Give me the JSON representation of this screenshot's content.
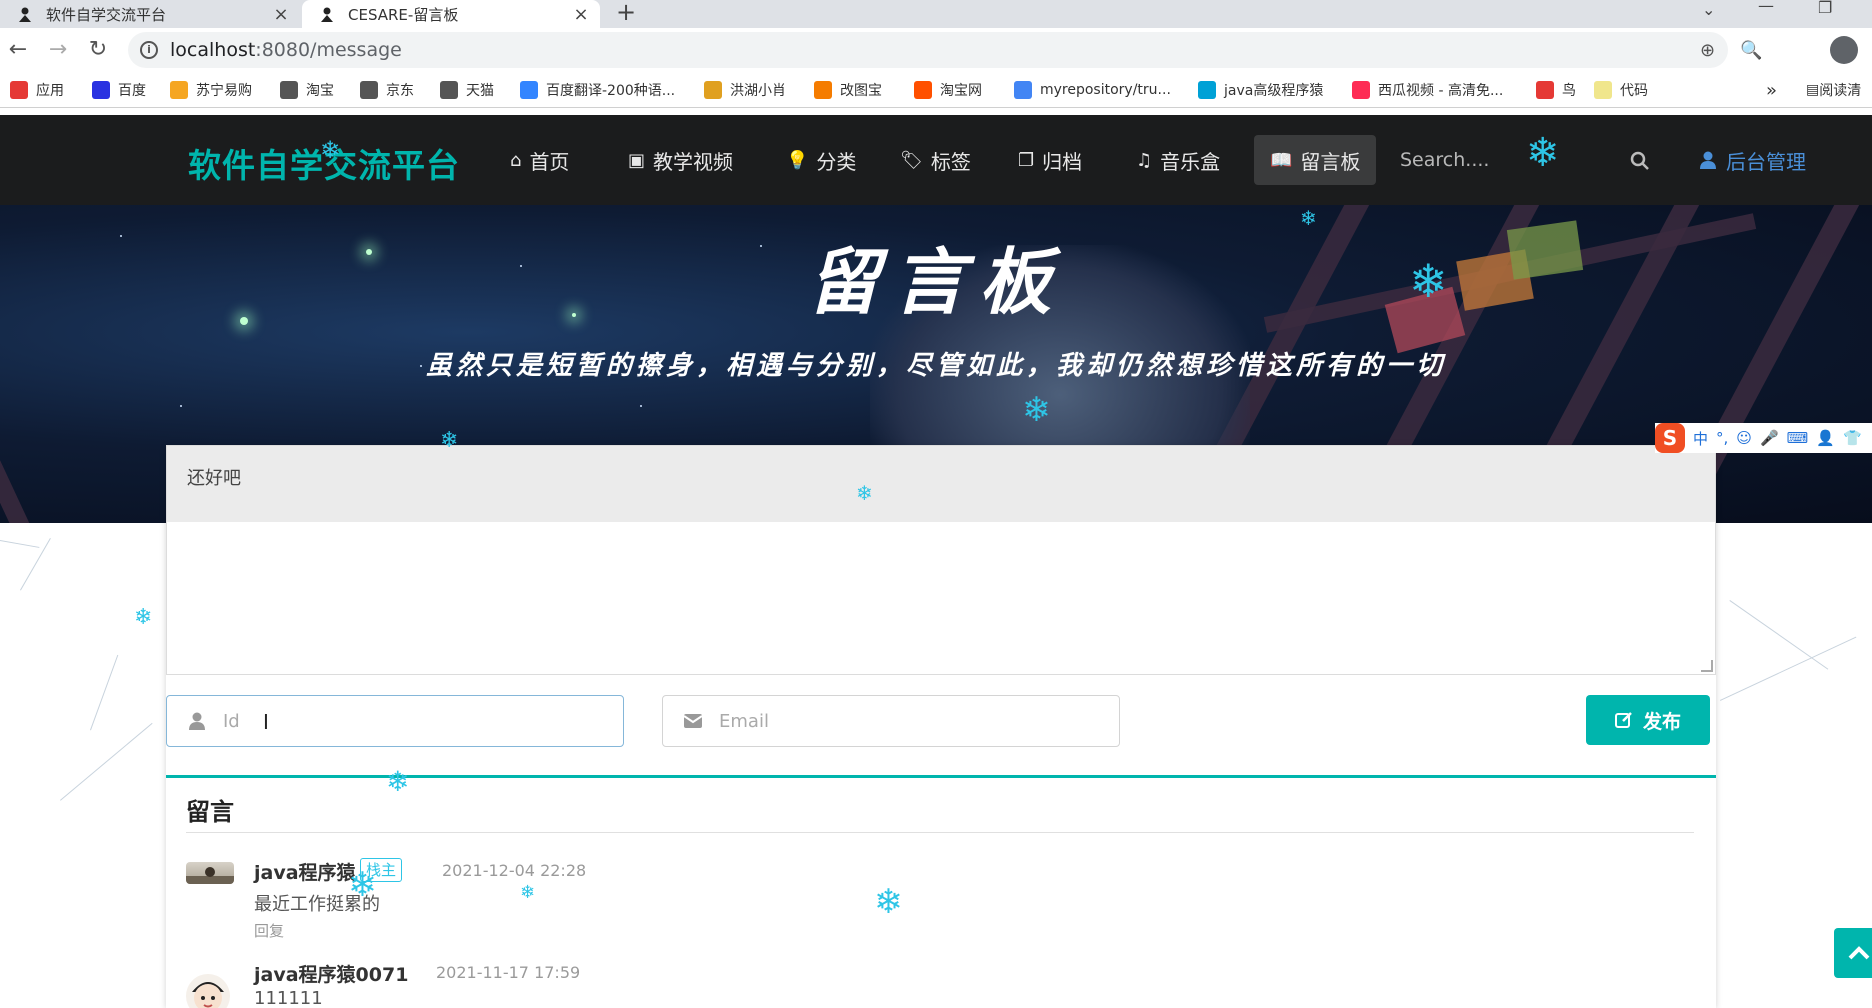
{
  "browser": {
    "tabs": [
      {
        "title": "软件自学交流平台",
        "close": "×"
      },
      {
        "title": "CESARE-留言板",
        "close": "×"
      }
    ],
    "new_tab": "+",
    "url_host": "localhost",
    "url_path": ":8080/message",
    "bookmarks": [
      {
        "label": "应用",
        "icon": "apps-grid-icon",
        "color": "#e53935"
      },
      {
        "label": "百度",
        "icon": "baidu-paw-icon",
        "color": "#2932e1"
      },
      {
        "label": "苏宁易购",
        "icon": "suning-icon",
        "color": "#f5a623"
      },
      {
        "label": "淘宝",
        "icon": "globe-icon",
        "color": "#555555"
      },
      {
        "label": "京东",
        "icon": "globe-icon",
        "color": "#555555"
      },
      {
        "label": "天猫",
        "icon": "globe-icon",
        "color": "#555555"
      },
      {
        "label": "百度翻译-200种语...",
        "icon": "translate-icon",
        "color": "#3385ff"
      },
      {
        "label": "洪湖小肖",
        "icon": "bird-icon",
        "color": "#e0a020"
      },
      {
        "label": "改图宝",
        "icon": "image-icon",
        "color": "#f57c00"
      },
      {
        "label": "淘宝网",
        "icon": "taobao-icon",
        "color": "#ff5000"
      },
      {
        "label": "myrepository/tru...",
        "icon": "chrome-icon",
        "color": "#4285f4"
      },
      {
        "label": "java高级程序猿",
        "icon": "bilibili-icon",
        "color": "#00a1d6"
      },
      {
        "label": "西瓜视频 - 高清免...",
        "icon": "xigua-icon",
        "color": "#fe2c55"
      },
      {
        "label": "鸟",
        "icon": "bird-red-icon",
        "color": "#e53935"
      },
      {
        "label": "代码",
        "icon": "code-icon",
        "color": "#f0e68c"
      }
    ],
    "bookmarks_more": "»",
    "reading_list": "阅读清"
  },
  "site": {
    "logo": "软件自学交流平台",
    "nav": [
      {
        "label": "首页",
        "icon": "home-icon",
        "glyph": "⌂"
      },
      {
        "label": "教学视频",
        "icon": "picture-icon",
        "glyph": "▣"
      },
      {
        "label": "分类",
        "icon": "lightbulb-icon",
        "glyph": "💡"
      },
      {
        "label": "标签",
        "icon": "tags-icon",
        "glyph": "🏷"
      },
      {
        "label": "归档",
        "icon": "clone-icon",
        "glyph": "❐"
      },
      {
        "label": "音乐盒",
        "icon": "music-icon",
        "glyph": "♫"
      },
      {
        "label": "留言板",
        "icon": "book-icon",
        "glyph": "📖"
      }
    ],
    "search_placeholder": "Search....",
    "admin": "后台管理"
  },
  "hero": {
    "title": "留言板",
    "subtitle": "虽然只是短暂的擦身，相遇与分别，尽管如此，我却仍然想珍惜这所有的一切"
  },
  "form": {
    "message": "还好吧",
    "id_placeholder": "Id",
    "email_placeholder": "Email",
    "publish": "发布"
  },
  "comments": {
    "header": "留言",
    "items": [
      {
        "author": "java程序猿",
        "badge": "栈主",
        "date": "2021-12-04 22:28",
        "text": "最近工作挺累的",
        "reply": "回复"
      },
      {
        "author": "java程序猿0071",
        "badge": "",
        "date": "2021-11-17 17:59",
        "text": "111111",
        "reply": ""
      }
    ]
  },
  "ime": {
    "logo": "S",
    "items": [
      "中",
      "°,",
      "☺",
      "🎤",
      "⌨",
      "👤",
      "👕"
    ]
  },
  "colors": {
    "accent": "#00b5ad",
    "snow": "#2ec5e6",
    "nav_bg": "#1b1c1d",
    "admin_link": "#4a8fd8"
  }
}
